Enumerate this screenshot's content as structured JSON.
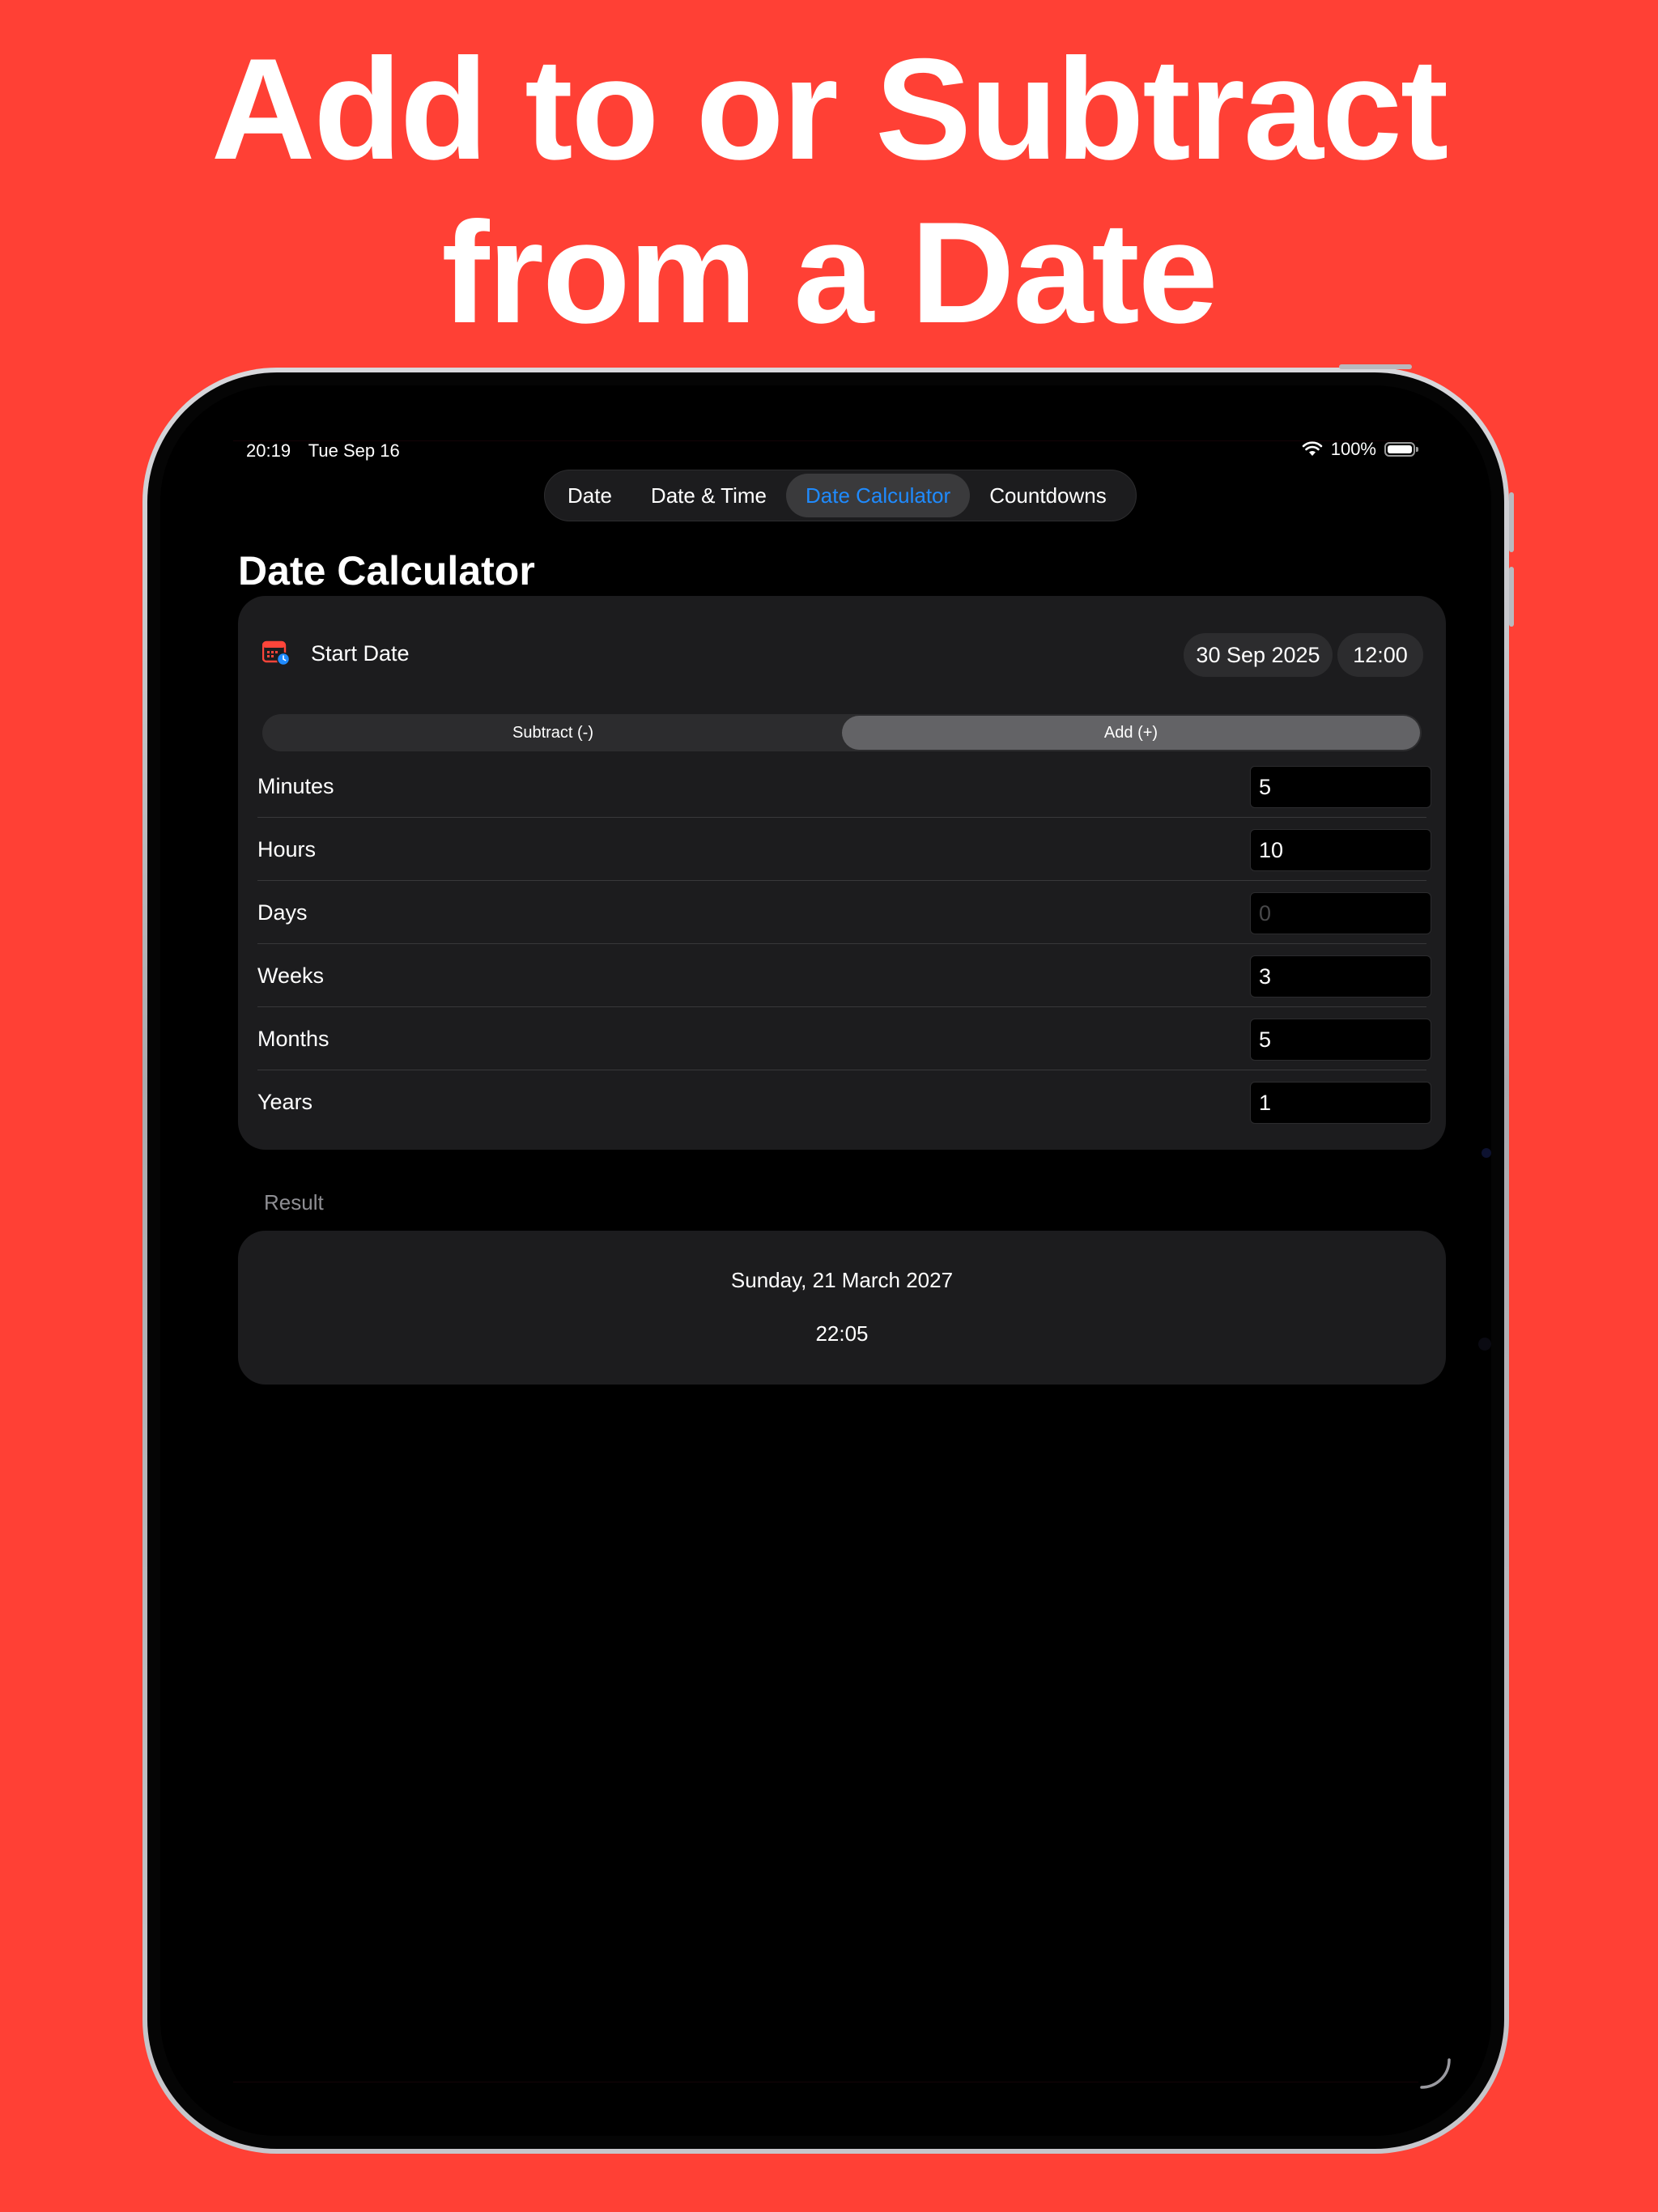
{
  "headline": {
    "line1": "Add to or Subtract",
    "line2": "from a Date"
  },
  "status_bar": {
    "time": "20:19",
    "date": "Tue Sep 16",
    "battery": "100%"
  },
  "tabs": [
    {
      "label": "Date",
      "active": false
    },
    {
      "label": "Date & Time",
      "active": false
    },
    {
      "label": "Date Calculator",
      "active": true
    },
    {
      "label": "Countdowns",
      "active": false
    }
  ],
  "page_title": "Date Calculator",
  "start": {
    "label": "Start Date",
    "date": "30 Sep 2025",
    "time": "12:00"
  },
  "operation": {
    "subtract_label": "Subtract (-)",
    "add_label": "Add (+)",
    "selected": "add"
  },
  "fields": [
    {
      "label": "Minutes",
      "value": "5",
      "placeholder": ""
    },
    {
      "label": "Hours",
      "value": "10",
      "placeholder": ""
    },
    {
      "label": "Days",
      "value": "",
      "placeholder": "0"
    },
    {
      "label": "Weeks",
      "value": "3",
      "placeholder": ""
    },
    {
      "label": "Months",
      "value": "5",
      "placeholder": ""
    },
    {
      "label": "Years",
      "value": "1",
      "placeholder": ""
    }
  ],
  "result": {
    "label": "Result",
    "date": "Sunday, 21 March 2027",
    "time": "22:05"
  },
  "colors": {
    "background": "#ff4035",
    "accent": "#1f8bff",
    "card": "#1c1c1e"
  },
  "icons": {
    "calendar": "calendar-clock-icon",
    "wifi": "wifi-icon",
    "battery": "battery-icon"
  }
}
